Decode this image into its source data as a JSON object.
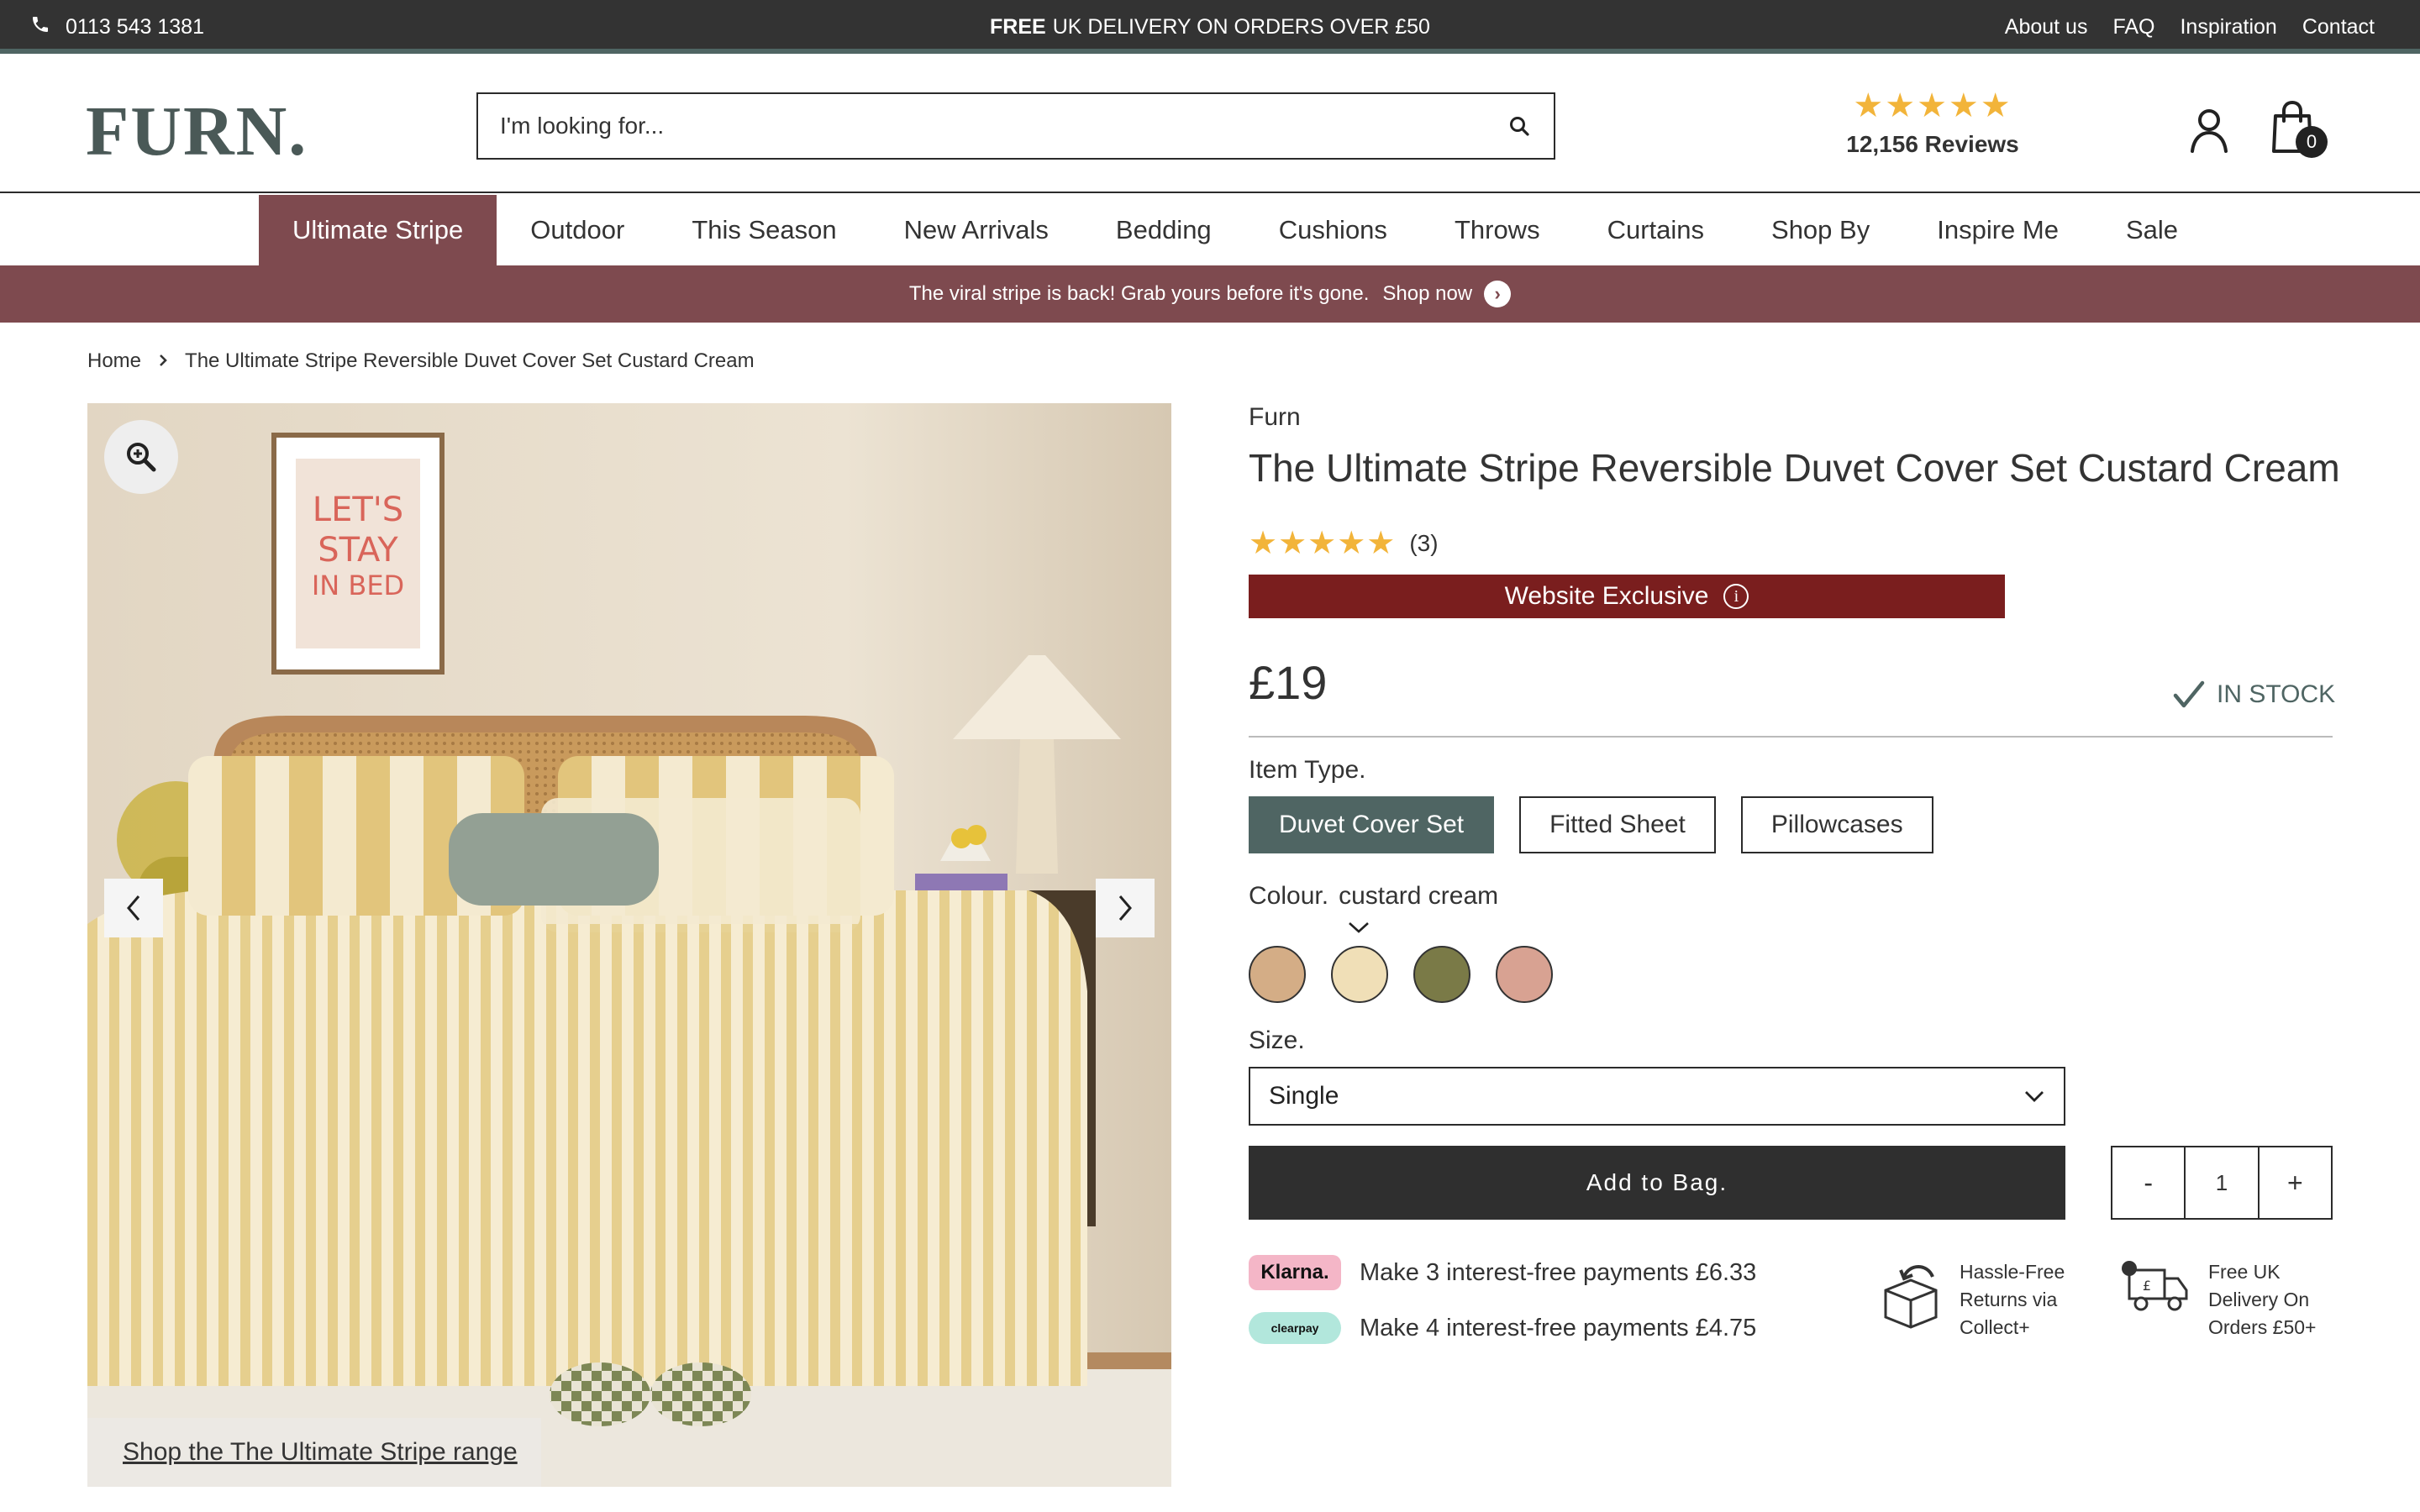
{
  "topbar": {
    "phone": "0113 543 1381",
    "promo_bold": "FREE",
    "promo_text": "UK DELIVERY ON ORDERS OVER £50",
    "links": [
      "About us",
      "FAQ",
      "Inspiration",
      "Contact"
    ]
  },
  "header": {
    "logo": "FURN.",
    "search_placeholder": "I'm looking for...",
    "reviews_stars": "★★★★★",
    "reviews_count": "12,156 Reviews",
    "bag_count": "0"
  },
  "nav": {
    "items": [
      "Ultimate Stripe",
      "Outdoor",
      "This Season",
      "New Arrivals",
      "Bedding",
      "Cushions",
      "Throws",
      "Curtains",
      "Shop By",
      "Inspire Me",
      "Sale"
    ],
    "active_index": 0
  },
  "banner": {
    "text": "The viral stripe is back! Grab yours before it's gone.",
    "link": "Shop now"
  },
  "breadcrumb": {
    "home": "Home",
    "current": "The Ultimate Stripe Reversible Duvet Cover Set Custard Cream"
  },
  "gallery": {
    "poster_text": [
      "LET'S",
      "STAY",
      "IN BED"
    ],
    "shop_range_link": "Shop the The Ultimate Stripe range"
  },
  "product": {
    "brand": "Furn",
    "title": "The Ultimate Stripe Reversible Duvet Cover Set Custard Cream",
    "rating_stars": "★★★★★",
    "review_count": "(3)",
    "exclusive_label": "Website Exclusive",
    "price": "£19",
    "stock": "IN STOCK",
    "item_type_label": "Item Type.",
    "item_types": [
      "Duvet Cover Set",
      "Fitted Sheet",
      "Pillowcases"
    ],
    "item_type_selected": 0,
    "colour_label": "Colour.",
    "colour_value": "custard cream",
    "swatches": [
      "#d4ad86",
      "#f0dfb7",
      "#7a7a47",
      "#d8a292"
    ],
    "swatch_selected": 1,
    "size_label": "Size.",
    "size_value": "Single",
    "add_to_bag": "Add to Bag.",
    "qty_minus": "-",
    "qty": "1",
    "qty_plus": "+"
  },
  "payments": {
    "klarna_logo": "Klarna.",
    "klarna_text": "Make 3 interest-free payments £6.33",
    "clearpay_logo": "clearpay",
    "clearpay_text": "Make 4 interest-free payments £4.75"
  },
  "features": {
    "returns": [
      "Hassle-Free",
      "Returns via",
      "Collect+"
    ],
    "delivery": [
      "Free UK",
      "Delivery On",
      "Orders £50+"
    ]
  },
  "colors": {
    "accent_burgundy": "#7e4a4f",
    "exclusive_red": "#7a1e1e",
    "slate_green": "#4f6563",
    "star_gold": "#f2b43a"
  }
}
